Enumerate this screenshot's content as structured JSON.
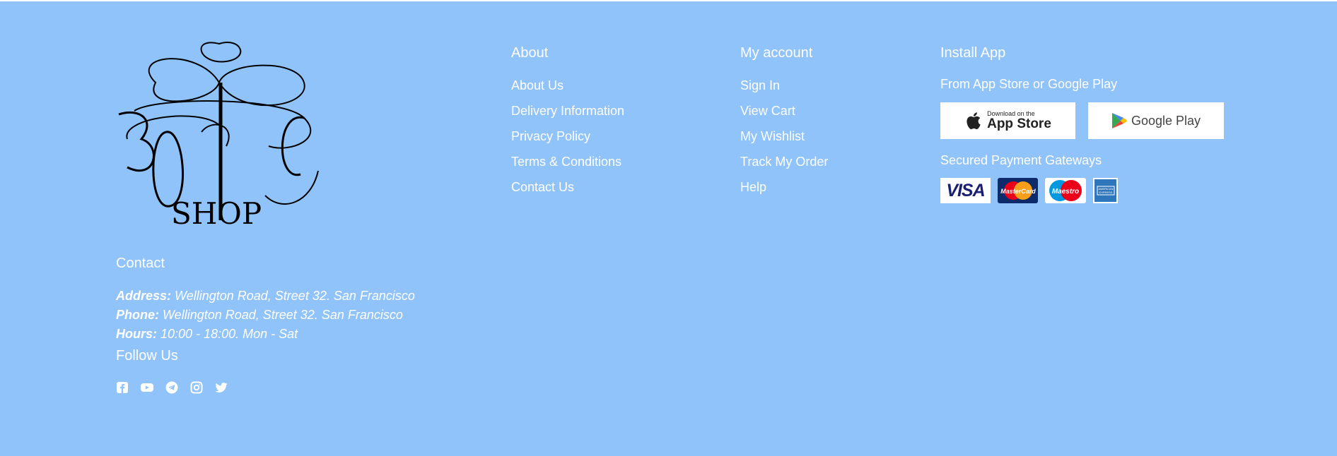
{
  "logo": {
    "text": "ЗОЛС SHOP"
  },
  "about": {
    "heading": "About",
    "links": [
      "About Us",
      "Delivery Information",
      "Privacy Policy",
      "Terms & Conditions",
      "Contact Us"
    ]
  },
  "account": {
    "heading": "My account",
    "links": [
      "Sign In",
      "View Cart",
      "My Wishlist",
      "Track My Order",
      "Help"
    ]
  },
  "app": {
    "heading": "Install App",
    "subtitle": "From App Store or Google Play",
    "appstore_small": "Download on the",
    "appstore_big": "App Store",
    "googleplay": "Google Play",
    "payments_label": "Secured Payment Gateways",
    "payment_methods": [
      "VISA",
      "MasterCard",
      "Maestro",
      "American Express"
    ]
  },
  "contact": {
    "heading": "Contact",
    "address_label": "Address:",
    "address_value": "Wellington Road, Street 32. San Francisco",
    "phone_label": "Phone:",
    "phone_value": "Wellington Road, Street 32. San Francisco",
    "hours_label": "Hours:",
    "hours_value": "10:00 - 18:00. Mon - Sat"
  },
  "follow": {
    "heading": "Follow Us",
    "icons": [
      "facebook-icon",
      "youtube-icon",
      "telegram-icon",
      "instagram-icon",
      "twitter-icon"
    ]
  },
  "colors": {
    "background": "#91c3fb",
    "text": "#ffffff"
  }
}
